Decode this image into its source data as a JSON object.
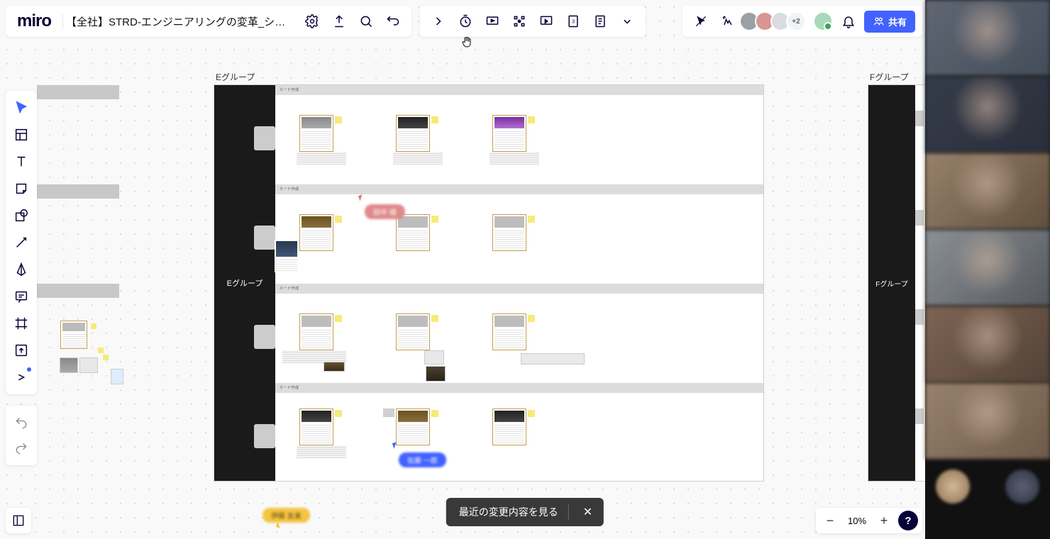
{
  "brand": "miro",
  "board_title": "【全社】STRD-エンジニアリングの変革_シグ...",
  "share_label": "共有",
  "avatar_overflow": "+2",
  "zoom": {
    "level": "10%"
  },
  "toast": {
    "message": "最近の変更内容を見る"
  },
  "frames": {
    "e_group_label": "Eグループ",
    "f_group_label": "Fグループ",
    "e_group_side": "Eグループ",
    "f_group_side": "Fグループ",
    "section_heading": "カード作成"
  },
  "cursors": {
    "red_label": "田中 様",
    "blue_label": "佐藤 一郎",
    "yellow_label": "伊藤 友美"
  },
  "tools": {
    "select": "select",
    "templates": "templates",
    "text": "text",
    "sticky": "sticky",
    "shape": "shape",
    "line": "connection-line",
    "pen": "pen",
    "comment": "comment",
    "frame": "frame",
    "upload": "upload",
    "more": "more"
  },
  "top_tools": {
    "settings": "settings",
    "export": "export",
    "search": "search",
    "switch": "switch",
    "expand": "expand",
    "timer": "timer",
    "presentation": "presentation",
    "attention": "attention",
    "screen": "screen-share",
    "voting": "voting",
    "notes": "notes",
    "more": "more",
    "hide": "hide-cursors",
    "reactions": "reactions",
    "notifications": "notifications"
  }
}
